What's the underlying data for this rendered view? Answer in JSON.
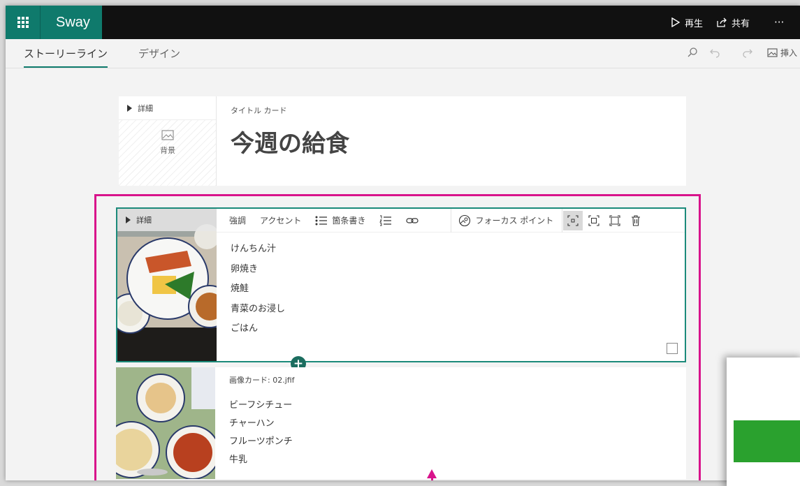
{
  "app": {
    "name": "Sway",
    "icons": {
      "waffle": "app-launcher-icon",
      "play": "play-icon",
      "share": "share-icon",
      "more": "more-icon"
    }
  },
  "header": {
    "play_label": "再生",
    "share_label": "共有",
    "more_label": "···"
  },
  "tabs": [
    {
      "label": "ストーリーライン",
      "active": true
    },
    {
      "label": "デザイン",
      "active": false
    }
  ],
  "tools": {
    "insert_label": "挿入",
    "icons": [
      "search-icon",
      "undo-icon",
      "redo-icon",
      "insert-image-icon"
    ]
  },
  "title_card": {
    "details_label": "詳細",
    "background_label": "背景",
    "card_type_label": "タイトル カード",
    "title": "今週の給食"
  },
  "text_card": {
    "details_label": "詳細",
    "toolbar": {
      "emphasis": "強調",
      "accent": "アクセント",
      "bullets": "箇条書き",
      "focus_point": "フォーカス ポイント"
    },
    "lines": [
      "けんちん汁",
      "卵焼き",
      "焼鮭",
      "青菜のお浸し",
      "ごはん"
    ]
  },
  "image_card": {
    "label": "画像カード: 02.jfif",
    "lines": [
      "ビーフシチュー",
      "チャーハン",
      "フルーツポンチ",
      "牛乳"
    ]
  },
  "colors": {
    "brand": "#0f7a6c",
    "highlight": "#d8138b",
    "selection": "#1b8a7a",
    "preview_green": "#2aa12e"
  }
}
